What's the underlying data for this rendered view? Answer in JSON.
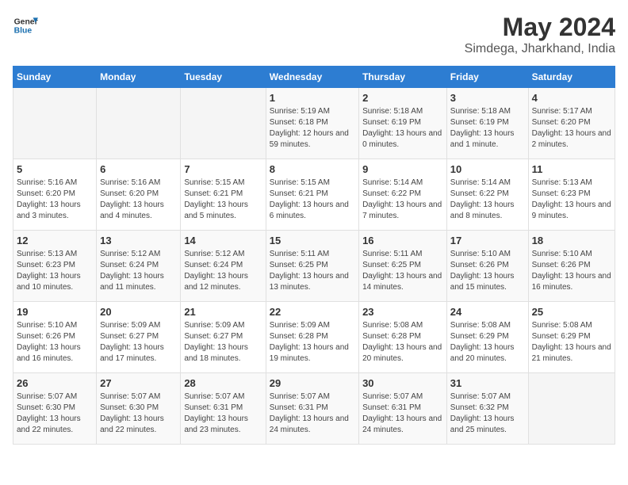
{
  "logo": {
    "line1": "General",
    "line2": "Blue"
  },
  "title": "May 2024",
  "subtitle": "Simdega, Jharkhand, India",
  "days_of_week": [
    "Sunday",
    "Monday",
    "Tuesday",
    "Wednesday",
    "Thursday",
    "Friday",
    "Saturday"
  ],
  "weeks": [
    [
      {
        "day": "",
        "info": ""
      },
      {
        "day": "",
        "info": ""
      },
      {
        "day": "",
        "info": ""
      },
      {
        "day": "1",
        "info": "Sunrise: 5:19 AM\nSunset: 6:18 PM\nDaylight: 12 hours and 59 minutes."
      },
      {
        "day": "2",
        "info": "Sunrise: 5:18 AM\nSunset: 6:19 PM\nDaylight: 13 hours and 0 minutes."
      },
      {
        "day": "3",
        "info": "Sunrise: 5:18 AM\nSunset: 6:19 PM\nDaylight: 13 hours and 1 minute."
      },
      {
        "day": "4",
        "info": "Sunrise: 5:17 AM\nSunset: 6:20 PM\nDaylight: 13 hours and 2 minutes."
      }
    ],
    [
      {
        "day": "5",
        "info": "Sunrise: 5:16 AM\nSunset: 6:20 PM\nDaylight: 13 hours and 3 minutes."
      },
      {
        "day": "6",
        "info": "Sunrise: 5:16 AM\nSunset: 6:20 PM\nDaylight: 13 hours and 4 minutes."
      },
      {
        "day": "7",
        "info": "Sunrise: 5:15 AM\nSunset: 6:21 PM\nDaylight: 13 hours and 5 minutes."
      },
      {
        "day": "8",
        "info": "Sunrise: 5:15 AM\nSunset: 6:21 PM\nDaylight: 13 hours and 6 minutes."
      },
      {
        "day": "9",
        "info": "Sunrise: 5:14 AM\nSunset: 6:22 PM\nDaylight: 13 hours and 7 minutes."
      },
      {
        "day": "10",
        "info": "Sunrise: 5:14 AM\nSunset: 6:22 PM\nDaylight: 13 hours and 8 minutes."
      },
      {
        "day": "11",
        "info": "Sunrise: 5:13 AM\nSunset: 6:23 PM\nDaylight: 13 hours and 9 minutes."
      }
    ],
    [
      {
        "day": "12",
        "info": "Sunrise: 5:13 AM\nSunset: 6:23 PM\nDaylight: 13 hours and 10 minutes."
      },
      {
        "day": "13",
        "info": "Sunrise: 5:12 AM\nSunset: 6:24 PM\nDaylight: 13 hours and 11 minutes."
      },
      {
        "day": "14",
        "info": "Sunrise: 5:12 AM\nSunset: 6:24 PM\nDaylight: 13 hours and 12 minutes."
      },
      {
        "day": "15",
        "info": "Sunrise: 5:11 AM\nSunset: 6:25 PM\nDaylight: 13 hours and 13 minutes."
      },
      {
        "day": "16",
        "info": "Sunrise: 5:11 AM\nSunset: 6:25 PM\nDaylight: 13 hours and 14 minutes."
      },
      {
        "day": "17",
        "info": "Sunrise: 5:10 AM\nSunset: 6:26 PM\nDaylight: 13 hours and 15 minutes."
      },
      {
        "day": "18",
        "info": "Sunrise: 5:10 AM\nSunset: 6:26 PM\nDaylight: 13 hours and 16 minutes."
      }
    ],
    [
      {
        "day": "19",
        "info": "Sunrise: 5:10 AM\nSunset: 6:26 PM\nDaylight: 13 hours and 16 minutes."
      },
      {
        "day": "20",
        "info": "Sunrise: 5:09 AM\nSunset: 6:27 PM\nDaylight: 13 hours and 17 minutes."
      },
      {
        "day": "21",
        "info": "Sunrise: 5:09 AM\nSunset: 6:27 PM\nDaylight: 13 hours and 18 minutes."
      },
      {
        "day": "22",
        "info": "Sunrise: 5:09 AM\nSunset: 6:28 PM\nDaylight: 13 hours and 19 minutes."
      },
      {
        "day": "23",
        "info": "Sunrise: 5:08 AM\nSunset: 6:28 PM\nDaylight: 13 hours and 20 minutes."
      },
      {
        "day": "24",
        "info": "Sunrise: 5:08 AM\nSunset: 6:29 PM\nDaylight: 13 hours and 20 minutes."
      },
      {
        "day": "25",
        "info": "Sunrise: 5:08 AM\nSunset: 6:29 PM\nDaylight: 13 hours and 21 minutes."
      }
    ],
    [
      {
        "day": "26",
        "info": "Sunrise: 5:07 AM\nSunset: 6:30 PM\nDaylight: 13 hours and 22 minutes."
      },
      {
        "day": "27",
        "info": "Sunrise: 5:07 AM\nSunset: 6:30 PM\nDaylight: 13 hours and 22 minutes."
      },
      {
        "day": "28",
        "info": "Sunrise: 5:07 AM\nSunset: 6:31 PM\nDaylight: 13 hours and 23 minutes."
      },
      {
        "day": "29",
        "info": "Sunrise: 5:07 AM\nSunset: 6:31 PM\nDaylight: 13 hours and 24 minutes."
      },
      {
        "day": "30",
        "info": "Sunrise: 5:07 AM\nSunset: 6:31 PM\nDaylight: 13 hours and 24 minutes."
      },
      {
        "day": "31",
        "info": "Sunrise: 5:07 AM\nSunset: 6:32 PM\nDaylight: 13 hours and 25 minutes."
      },
      {
        "day": "",
        "info": ""
      }
    ]
  ]
}
